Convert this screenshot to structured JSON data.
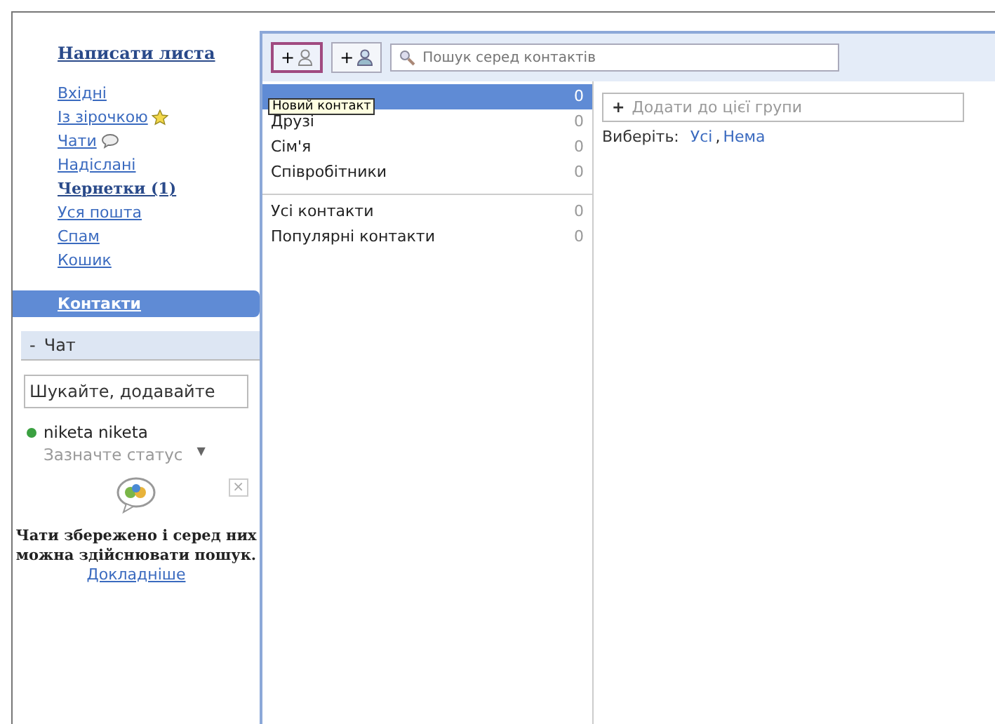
{
  "sidebar": {
    "compose": "Написати листа",
    "folders": [
      {
        "label": "Вхідні",
        "bold": false,
        "kind": "plain"
      },
      {
        "label": "Із зірочкою",
        "bold": false,
        "kind": "starred"
      },
      {
        "label": "Чати",
        "bold": false,
        "kind": "chats"
      },
      {
        "label": "Надіслані",
        "bold": false,
        "kind": "plain"
      },
      {
        "label": "Чернетки (1)",
        "bold": true,
        "kind": "plain"
      },
      {
        "label": "Уся пошта",
        "bold": false,
        "kind": "plain"
      },
      {
        "label": "Спам",
        "bold": false,
        "kind": "plain"
      },
      {
        "label": "Кошик",
        "bold": false,
        "kind": "plain"
      }
    ],
    "contacts": {
      "label": "Контакти",
      "selected": true
    }
  },
  "chat": {
    "toggle": "-",
    "title": "Чат",
    "search": {
      "placeholder": "Шукайте, додавайте"
    },
    "user": {
      "name": "niketa niketa",
      "color": "#3aa040",
      "status": "Зазначте статус",
      "caret": "▼"
    },
    "promo": {
      "close": "×",
      "text": "Чати збережено і серед них можна здійснювати пошук.",
      "link": "Докладніше"
    }
  },
  "toolbar": {
    "buttons": [
      {
        "label": "+",
        "highlighted": true
      },
      {
        "label": "+",
        "highlighted": false
      }
    ],
    "search": {
      "placeholder": "Пошук серед контактів"
    },
    "tooltip": "Новий контакт"
  },
  "groups": [
    {
      "count": "0",
      "selected": true,
      "divider": false
    },
    {
      "label": "Друзі",
      "count": "0",
      "selected": false,
      "divider": false
    },
    {
      "label": "Сім'я",
      "count": "0",
      "selected": false,
      "divider": false
    },
    {
      "label": "Співробітники",
      "count": "0",
      "selected": false,
      "divider": false
    },
    {
      "label": "Усі контакти",
      "count": "0",
      "selected": false,
      "divider": true
    },
    {
      "label": "Популярні контакти",
      "count": "0",
      "selected": false,
      "divider": false
    }
  ],
  "detail": {
    "add_plus": "+",
    "add_label": "Додати до цієї групи",
    "select_label": "Виберіть:",
    "select_links": [
      "Усі",
      "Нема"
    ],
    "separator": ","
  }
}
